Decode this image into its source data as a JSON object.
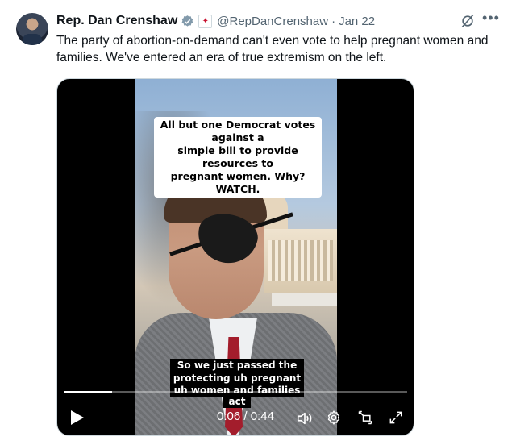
{
  "author": {
    "name": "Rep. Dan Crenshaw",
    "handle": "@RepDanCrenshaw",
    "separator": "·",
    "date": "Jan 22",
    "verified_color": "#829aab",
    "affiliation_icon": "congress-seal-icon"
  },
  "tweet": {
    "text": "The party of abortion-on-demand can't even vote to help pregnant women and families. We've entered an era of true extremism on the left."
  },
  "video": {
    "caption_top": [
      "All but one Democrat votes against a",
      "simple bill to provide resources to",
      "pregnant women. Why? WATCH."
    ],
    "subtitles": [
      "So we just passed the uh",
      "protecting uh pregnant",
      "uh women and families",
      "act"
    ],
    "time_current": "0:06",
    "time_separator": "/",
    "time_total": "0:44",
    "progress": 0.14
  },
  "icons": {
    "play": "play-icon",
    "volume": "volume-icon",
    "settings": "gear-icon",
    "pip": "picture-in-picture-icon",
    "fullscreen": "expand-icon",
    "grok": "grok-icon",
    "more": "more-icon"
  },
  "colors": {
    "text": "#0f1419",
    "secondary": "#536471",
    "border": "#cfd9de"
  }
}
